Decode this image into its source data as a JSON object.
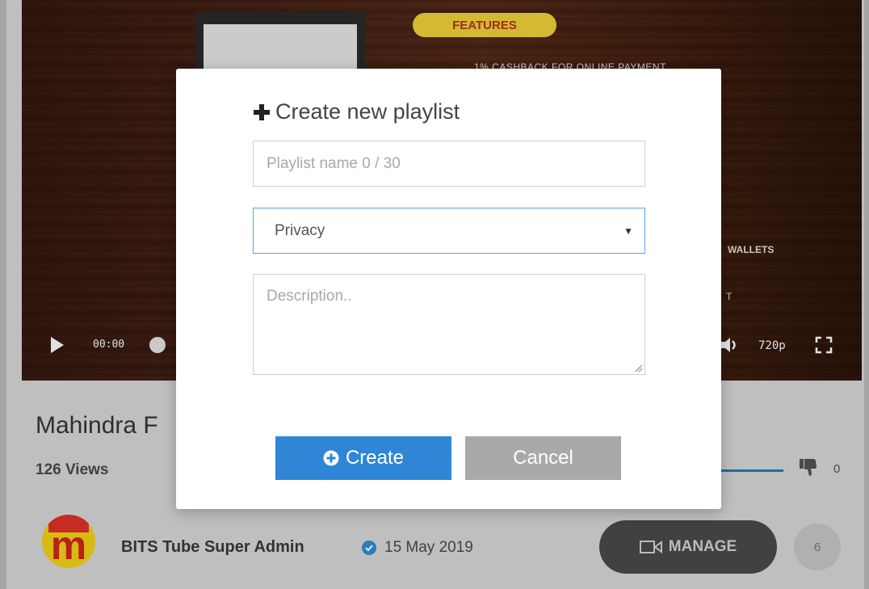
{
  "background": {
    "player": {
      "features_badge": "FEATURES",
      "promo_line": "1% CASHBACK FOR ONLINE PAYMENT",
      "promo_wallets": "WALLETS",
      "promo_partial": "T",
      "time": "00:00",
      "quality": "720p",
      "icons": [
        "play-icon",
        "volume-icon",
        "fullscreen-icon"
      ]
    },
    "video": {
      "title": "Mahindra F",
      "views": "126 Views",
      "dislike_count": "0"
    },
    "channel": {
      "avatar_letter": "m",
      "name": "BITS Tube Super Admin",
      "upload_date": "15 May 2019",
      "manage_label": "MANAGE",
      "count_badge": "6"
    }
  },
  "modal": {
    "title": "Create new playlist",
    "name_input": {
      "value": "",
      "placeholder": "Playlist name 0 / 30"
    },
    "privacy": {
      "selected": "Privacy"
    },
    "description": {
      "value": "",
      "placeholder": "Description.."
    },
    "buttons": {
      "create": "Create",
      "cancel": "Cancel"
    }
  },
  "colors": {
    "primary": "#2f86d6",
    "cancel": "#a9a9a9",
    "focus_border": "#5aa1e3",
    "verified": "#2e8fd8"
  }
}
